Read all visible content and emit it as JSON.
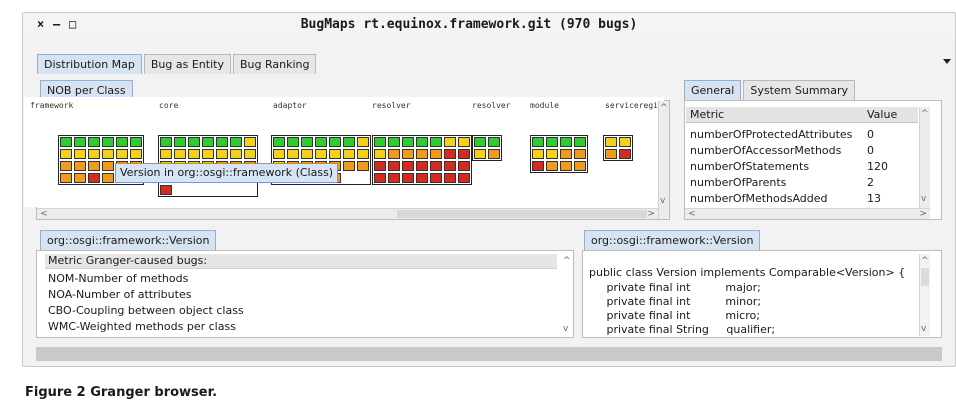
{
  "window": {
    "close": "×",
    "minimize": "–",
    "maximize": "□",
    "title": "BugMaps rt.equinox.framework.git (970 bugs)"
  },
  "main_tabs": [
    "Distribution Map",
    "Bug as Entity",
    "Bug Ranking"
  ],
  "nob_panel": {
    "tab": "NOB per Class"
  },
  "colors": {
    "green": "#2ecc2e",
    "yellow": "#f4d21c",
    "orange": "#f29a1d",
    "red": "#d42a1f",
    "tab_active": "#d7e3f1",
    "tooltip": "#d6e4f4"
  },
  "packages": [
    {
      "label": "framework",
      "cells": [
        "green",
        "green",
        "green",
        "green",
        "green",
        "green",
        "yellow",
        "yellow",
        "yellow",
        "yellow",
        "yellow",
        "yellow",
        "orange",
        "orange",
        "orange",
        "orange",
        "orange",
        "orange",
        "orange",
        "orange",
        "red",
        "orange"
      ]
    },
    {
      "label": "core",
      "cells": [
        "green",
        "green",
        "green",
        "green",
        "green",
        "green",
        "yellow",
        "yellow",
        "yellow",
        "yellow",
        "yellow",
        "yellow",
        "yellow",
        "yellow",
        "yellow",
        "yellow",
        "yellow",
        "yellow",
        "orange",
        "orange",
        "orange",
        "orange",
        "orange",
        "orange",
        "red",
        "red",
        "red",
        "red",
        "red"
      ]
    },
    {
      "label": "adaptor",
      "cells": [
        "green",
        "green",
        "green",
        "green",
        "green",
        "green",
        "yellow",
        "yellow",
        "yellow",
        "yellow",
        "yellow",
        "yellow",
        "yellow",
        "yellow",
        "yellow",
        "orange",
        "orange",
        "orange",
        "orange",
        "orange",
        "orange",
        "orange",
        "orange",
        "orange",
        "orange",
        "orange"
      ]
    },
    {
      "label": "resolver",
      "cells": [
        "green",
        "green",
        "green",
        "green",
        "green",
        "yellow",
        "yellow",
        "yellow",
        "orange",
        "orange",
        "orange",
        "orange",
        "red",
        "red",
        "red",
        "red",
        "red",
        "red",
        "red",
        "red",
        "red",
        "red",
        "red",
        "red",
        "red",
        "red",
        "red",
        "red"
      ]
    },
    {
      "label": "resolver",
      "cells": [
        "green",
        "green",
        "yellow",
        "orange"
      ]
    },
    {
      "label": "module",
      "cells": [
        "green",
        "green",
        "green",
        "green",
        "yellow",
        "yellow",
        "orange",
        "orange",
        "red",
        "orange",
        "orange",
        "orange"
      ]
    },
    {
      "label": "serviceregis",
      "cells": [
        "yellow",
        "yellow",
        "orange",
        "red"
      ]
    }
  ],
  "tooltip": "Version in org::osgi::framework (Class)",
  "right_tabs": [
    "General",
    "System Summary"
  ],
  "metrics_table": {
    "headers": [
      "Metric",
      "Value"
    ],
    "rows": [
      {
        "name": "numberOfProtectedAttributes",
        "value": "0"
      },
      {
        "name": "numberOfAccessorMethods",
        "value": "0"
      },
      {
        "name": "numberOfStatements",
        "value": "120"
      },
      {
        "name": "numberOfParents",
        "value": "2"
      },
      {
        "name": "numberOfMethodsAdded",
        "value": "13"
      }
    ]
  },
  "bottom_left": {
    "tab": "org::osgi::framework::Version",
    "header": "Metric Granger-caused bugs:",
    "items": [
      "NOM-Number of methods",
      "NOA-Number of attributes",
      "CBO-Coupling between object class",
      "WMC-Weighted methods per class"
    ]
  },
  "bottom_right": {
    "tab": "org::osgi::framework::Version",
    "code_lines": [
      "public class Version implements Comparable<Version> {",
      "     private final int          major;",
      "     private final int          minor;",
      "     private final int          micro;",
      "     private final String     qualifier;"
    ]
  },
  "caption": "Figure 2 Granger browser."
}
